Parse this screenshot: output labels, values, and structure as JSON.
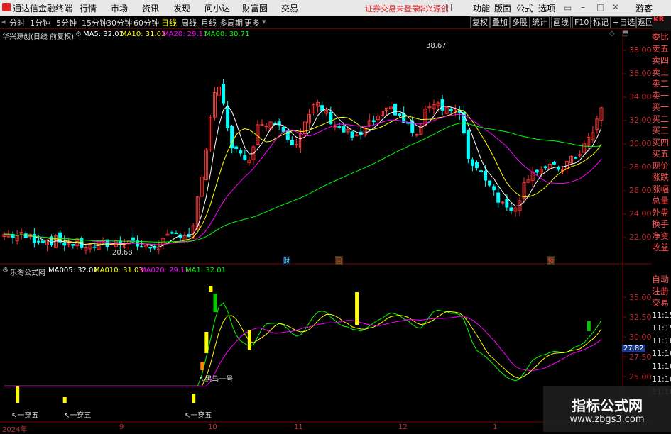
{
  "titlebar": {
    "app_title": "通达信金融终端",
    "menus": [
      "行情",
      "市场",
      "资讯",
      "发现",
      "问小达",
      "财富圈",
      "交易"
    ],
    "status_text": "证券交易未登录",
    "stock_name": "华兴源创",
    "right_buttons": [
      "功能",
      "版面",
      "公式",
      "选项"
    ],
    "guest": "游客"
  },
  "toolbar": {
    "periods": [
      "分时",
      "1分钟",
      "5分钟",
      "15分钟",
      "30分钟",
      "60分钟",
      "日线",
      "周线",
      "月线",
      "多周期",
      "更多"
    ],
    "selected": "日线",
    "right_buttons": [
      "复权",
      "叠加",
      "多股",
      "统计",
      "画线",
      "F10",
      "标记",
      "+自选",
      "返回"
    ]
  },
  "main_chart": {
    "title": "华兴源创(日线 前复权)",
    "ma": [
      {
        "label": "MA5: 32.01",
        "color": "#ffffff"
      },
      {
        "label": "MA10: 31.03",
        "color": "#ffff00"
      },
      {
        "label": "MA20: 29.11",
        "color": "#ff00ff"
      },
      {
        "label": "MA60: 30.71",
        "color": "#00ff00"
      }
    ],
    "y_ticks": [
      "38.00",
      "36.00",
      "34.00",
      "32.00",
      "30.00",
      "28.00",
      "26.00",
      "24.00",
      "22.00"
    ],
    "high_label": "38.67",
    "low_label": "20.68",
    "event_tags": [
      "财",
      "回",
      "预"
    ]
  },
  "indicator": {
    "title": "乐淘公式网",
    "lines": [
      {
        "label": "MA005: 32.01",
        "color": "#ffffff"
      },
      {
        "label": "MA010: 31.03",
        "color": "#ffff00"
      },
      {
        "label": "MA020: 29.11",
        "color": "#ff00ff"
      },
      {
        "label": "MA1: 32.01",
        "color": "#00ff00"
      }
    ],
    "y_ticks": [
      "35.00",
      "32.50",
      "30.00",
      "27.50",
      "25.00"
    ],
    "current_value": "27.82",
    "labels": [
      "一穿五",
      "一穿五",
      "一穿五",
      "黑马一号"
    ]
  },
  "x_axis": [
    "2024年",
    "9",
    "10",
    "11",
    "12",
    "1"
  ],
  "side_panel": {
    "top": "KR",
    "items": [
      "委比",
      "卖五",
      "卖四",
      "卖三",
      "卖二",
      "卖一",
      "买一",
      "买二",
      "买三",
      "买四",
      "买五",
      "现价",
      "涨跌",
      "涨幅",
      "总量",
      "外盘",
      "换手",
      "净资",
      "收益"
    ],
    "lower": [
      "自动",
      "注册",
      "交易"
    ],
    "times": [
      "11:15",
      "11:15",
      "11:16",
      "11:16",
      "11:16",
      "11:16",
      "11:16"
    ]
  },
  "watermark": {
    "title": "指标公式网",
    "url": "www.zbgs3.com"
  },
  "colors": {
    "up": "#ff3232",
    "down": "#00ffff",
    "ma5": "#ffffff",
    "ma10": "#ffff00",
    "ma20": "#ff00ff",
    "ma60": "#00ff00"
  }
}
